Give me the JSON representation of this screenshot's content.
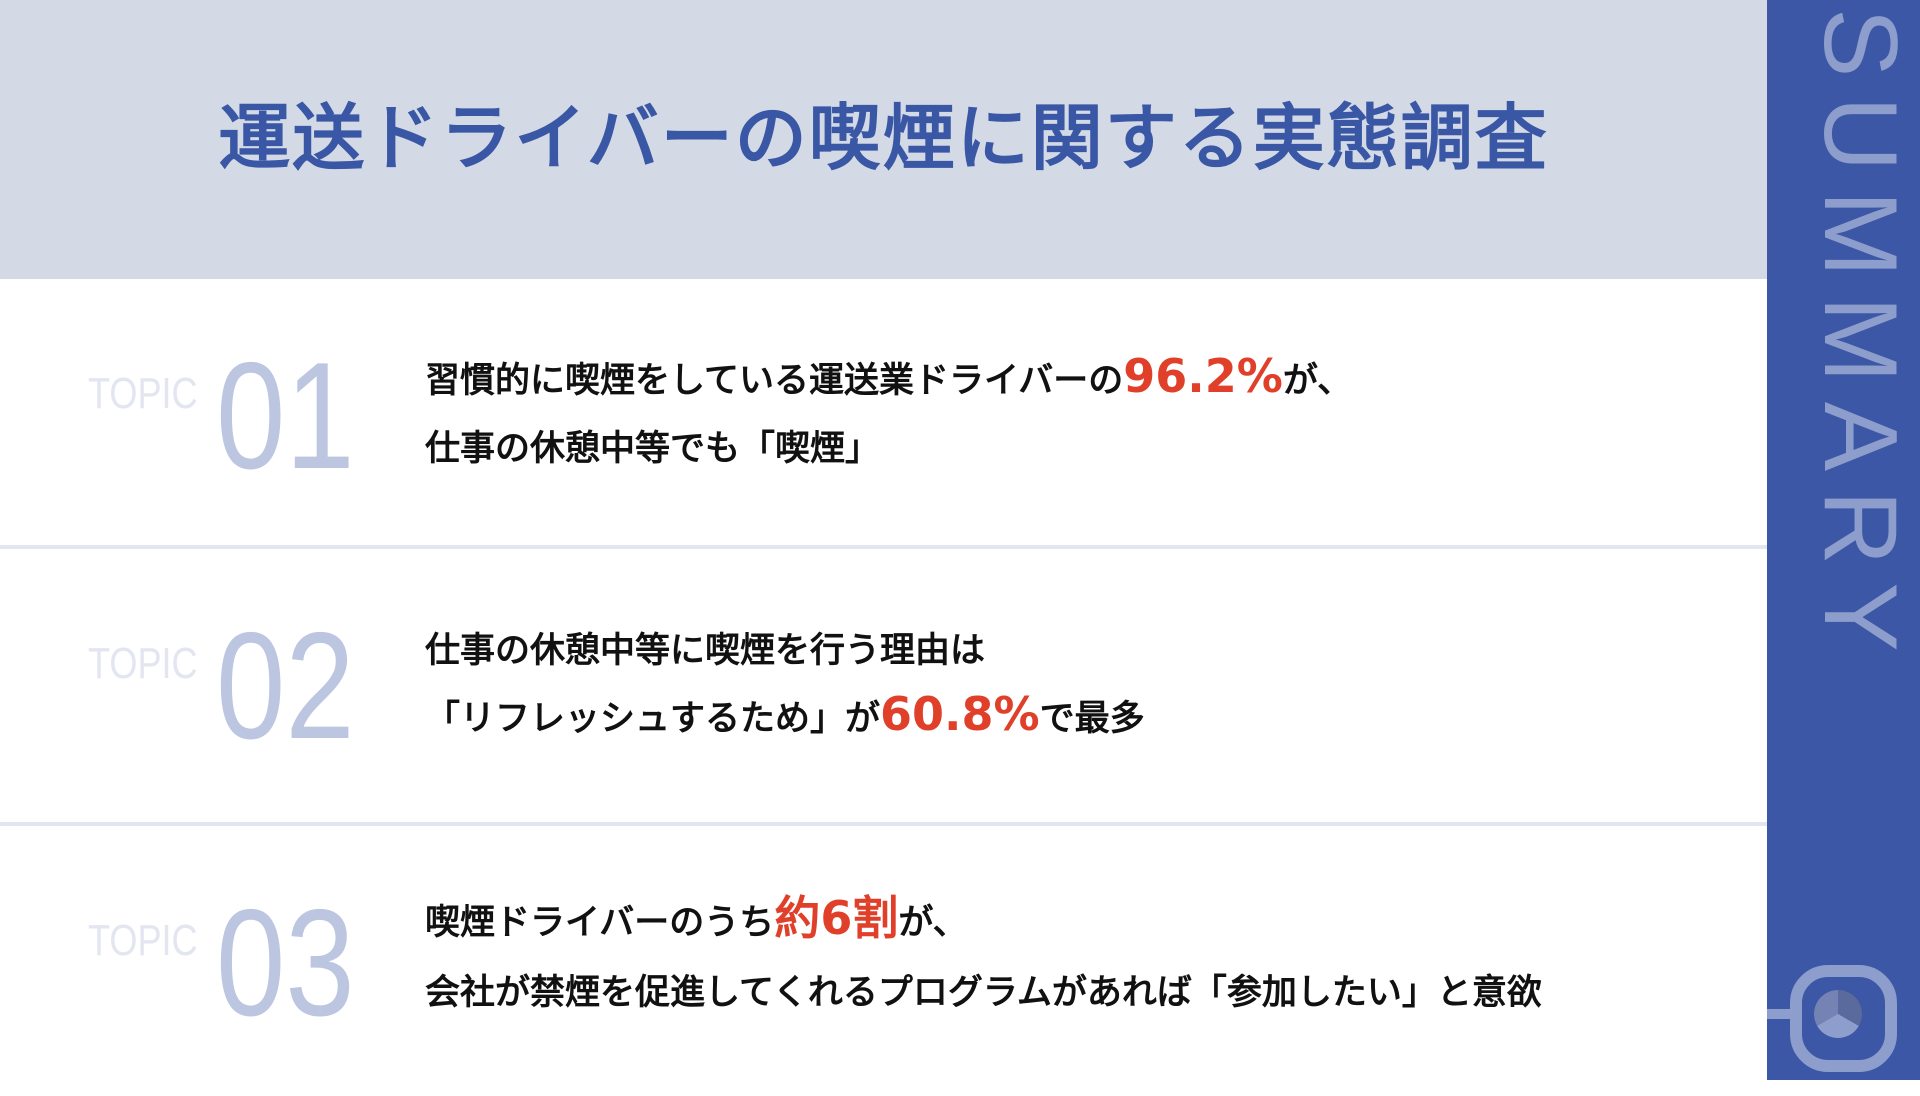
{
  "header": {
    "title": "運送ドライバーの喫煙に関する実態調査"
  },
  "sidebar": {
    "label": "SUMMARY",
    "icon": "chart-pie-icon"
  },
  "colors": {
    "accent": "#3c57a5",
    "highlight": "#e0402a",
    "header_bg": "#d3dae6"
  },
  "topics": [
    {
      "label": "TOPIC",
      "number": "01",
      "line1_pre": "習慣的に喫煙をしている運送業ドライバーの",
      "line1_hl": "96.2%",
      "line1_post": "が、",
      "line2_pre": "仕事の休憩中等でも「喫煙」",
      "line2_hl": "",
      "line2_post": ""
    },
    {
      "label": "TOPIC",
      "number": "02",
      "line1_pre": "仕事の休憩中等に喫煙を行う理由は",
      "line1_hl": "",
      "line1_post": "",
      "line2_pre": "「リフレッシュするため」が",
      "line2_hl": "60.8%",
      "line2_post": "で最多"
    },
    {
      "label": "TOPIC",
      "number": "03",
      "line1_pre": "喫煙ドライバーのうち",
      "line1_hl": "約6割",
      "line1_post": "が、",
      "line2_pre": "会社が禁煙を促進してくれるプログラムがあれば「参加したい」と意欲",
      "line2_hl": "",
      "line2_post": ""
    }
  ]
}
